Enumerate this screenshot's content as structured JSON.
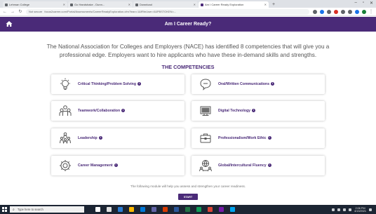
{
  "browser": {
    "tabs": [
      {
        "label": "Lehman College",
        "active": false
      },
      {
        "label": "Go Handshake - Dunn...",
        "active": false
      },
      {
        "label": "Download",
        "active": false
      },
      {
        "label": "Am I Career Ready Exploration",
        "active": true
      }
    ],
    "new_tab": "+",
    "address_warning": "Not secure",
    "address": "focus2career.com/Portal/Assessments/CareerReadyExploration.cfm?lean=1&fRtnUser=0&PBSTOKEN=..."
  },
  "header": {
    "title": "Am I Career Ready?"
  },
  "intro": "The National Association for Colleges and Employers (NACE) has identified 8 competencies that will give you a professional edge. Employers want to hire applicants who have these in-demand skills and strengths.",
  "competencies_heading": "THE COMPETENCIES",
  "competencies": [
    {
      "label": "Critical Thinking/Problem Solving",
      "icon": "lightbulb-icon"
    },
    {
      "label": "Oral/Written Communications",
      "icon": "speech-bubble-icon"
    },
    {
      "label": "Teamwork/Collaboration",
      "icon": "team-icon"
    },
    {
      "label": "Digital Technology",
      "icon": "computer-icon"
    },
    {
      "label": "Leadership",
      "icon": "leadership-icon"
    },
    {
      "label": "Professionalism/Work Ethic",
      "icon": "briefcase-icon"
    },
    {
      "label": "Career Management",
      "icon": "gears-icon"
    },
    {
      "label": "Global/Intercultural Fluency",
      "icon": "global-people-icon"
    }
  ],
  "help_text": "The following module will help you assess and strengthen your career readiness.",
  "start_label": "START",
  "taskbar": {
    "search_placeholder": "Type here to search",
    "time": "2:06 PM",
    "date": "4/13/2021"
  },
  "colors": {
    "brand": "#4a2a78"
  }
}
